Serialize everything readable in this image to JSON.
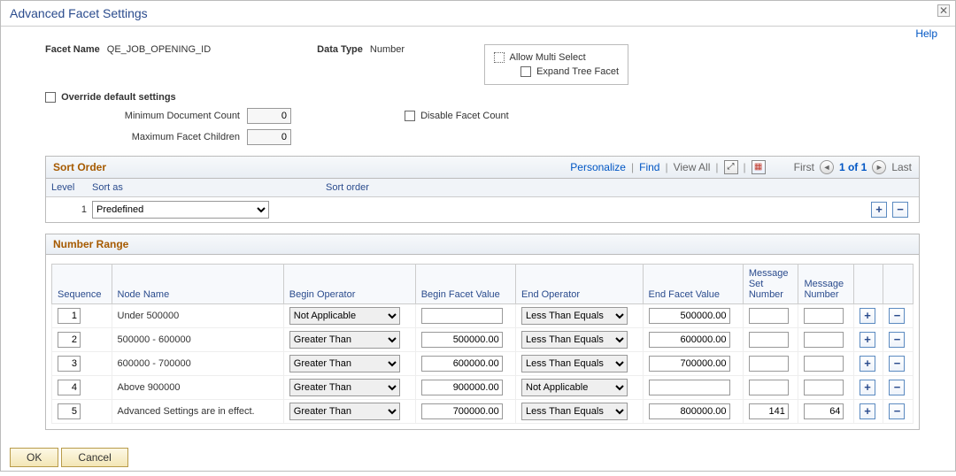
{
  "title": "Advanced Facet Settings",
  "helpLabel": "Help",
  "fields": {
    "facetNameLabel": "Facet Name",
    "facetNameValue": "QE_JOB_OPENING_ID",
    "dataTypeLabel": "Data Type",
    "dataTypeValue": "Number",
    "allowMultiSelect": "Allow Multi Select",
    "expandTreeFacet": "Expand Tree Facet",
    "overrideDefault": "Override default settings",
    "minDocCountLabel": "Minimum Document Count",
    "minDocCountValue": "0",
    "maxFacetChildrenLabel": "Maximum Facet Children",
    "maxFacetChildrenValue": "0",
    "disableFacetCount": "Disable Facet Count"
  },
  "sortOrder": {
    "title": "Sort Order",
    "toolbar": {
      "personalize": "Personalize",
      "find": "Find",
      "viewAll": "View All",
      "first": "First",
      "counter": "1 of 1",
      "last": "Last"
    },
    "headers": {
      "level": "Level",
      "sortAs": "Sort as",
      "sortOrder": "Sort order"
    },
    "row": {
      "level": "1",
      "sortAs": "Predefined",
      "sortOrder": ""
    }
  },
  "numberRange": {
    "title": "Number Range",
    "headers": {
      "sequence": "Sequence",
      "nodeName": "Node Name",
      "beginOp": "Begin Operator",
      "beginVal": "Begin Facet Value",
      "endOp": "End Operator",
      "endVal": "End Facet Value",
      "msgSet": "Message Set Number",
      "msgNum": "Message Number"
    },
    "rows": [
      {
        "seq": "1",
        "node": "Under 500000",
        "bop": "Not Applicable",
        "bval": "",
        "eop": "Less Than Equals",
        "eval": "500000.00",
        "mset": "",
        "mnum": ""
      },
      {
        "seq": "2",
        "node": "500000 - 600000",
        "bop": "Greater Than",
        "bval": "500000.00",
        "eop": "Less Than Equals",
        "eval": "600000.00",
        "mset": "",
        "mnum": ""
      },
      {
        "seq": "3",
        "node": "600000 - 700000",
        "bop": "Greater Than",
        "bval": "600000.00",
        "eop": "Less Than Equals",
        "eval": "700000.00",
        "mset": "",
        "mnum": ""
      },
      {
        "seq": "4",
        "node": "Above 900000",
        "bop": "Greater Than",
        "bval": "900000.00",
        "eop": "Not Applicable",
        "eval": "",
        "mset": "",
        "mnum": ""
      },
      {
        "seq": "5",
        "node": "Advanced Settings are in effect.",
        "bop": "Greater Than",
        "bval": "700000.00",
        "eop": "Less Than Equals",
        "eval": "800000.00",
        "mset": "141",
        "mnum": "64"
      }
    ]
  },
  "buttons": {
    "ok": "OK",
    "cancel": "Cancel"
  }
}
